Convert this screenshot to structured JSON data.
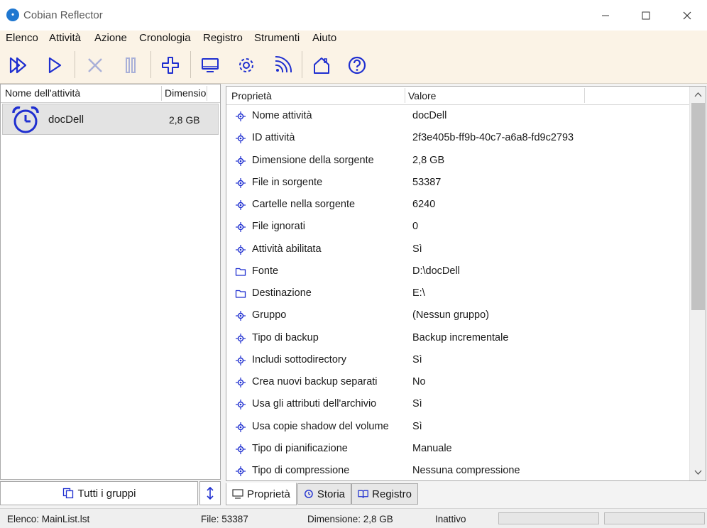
{
  "window": {
    "title": "Cobian Reflector"
  },
  "menu": [
    "Elenco",
    "Attività",
    "Azione",
    "Cronologia",
    "Registro",
    "Strumenti",
    "Aiuto"
  ],
  "toolbar": [
    "run-all-icon",
    "run-icon",
    "cancel-icon",
    "pause-icon",
    "add-icon",
    "monitor-icon",
    "settings-icon",
    "network-icon",
    "home-icon",
    "help-icon"
  ],
  "task_list": {
    "col_name": "Nome dell'attività",
    "col_size": "Dimensione",
    "items": [
      {
        "name": "docDell",
        "size": "2,8 GB",
        "icon": "alarm-clock-icon"
      }
    ],
    "group_button": "Tutti i gruppi"
  },
  "properties": {
    "col_property": "Proprietà",
    "col_value": "Valore",
    "rows": [
      {
        "name": "Nome attività",
        "value": "docDell",
        "icon": "property-icon"
      },
      {
        "name": "ID attività",
        "value": "2f3e405b-ff9b-40c7-a6a8-fd9c2793",
        "icon": "property-icon"
      },
      {
        "name": "Dimensione della sorgente",
        "value": "2,8 GB",
        "icon": "property-icon"
      },
      {
        "name": "File in sorgente",
        "value": "53387",
        "icon": "property-icon"
      },
      {
        "name": "Cartelle nella sorgente",
        "value": "6240",
        "icon": "property-icon"
      },
      {
        "name": "File ignorati",
        "value": "0",
        "icon": "property-icon"
      },
      {
        "name": "Attività abilitata",
        "value": "Sì",
        "icon": "property-icon"
      },
      {
        "name": "Fonte",
        "value": "D:\\docDell",
        "icon": "folder-icon"
      },
      {
        "name": "Destinazione",
        "value": "E:\\",
        "icon": "folder-icon"
      },
      {
        "name": "Gruppo",
        "value": "(Nessun gruppo)",
        "icon": "property-icon"
      },
      {
        "name": "Tipo di backup",
        "value": "Backup incrementale",
        "icon": "property-icon"
      },
      {
        "name": "Includi sottodirectory",
        "value": "Sì",
        "icon": "property-icon"
      },
      {
        "name": "Crea nuovi backup separati",
        "value": "No",
        "icon": "property-icon"
      },
      {
        "name": "Usa gli attributi dell'archivio",
        "value": "Sì",
        "icon": "property-icon"
      },
      {
        "name": "Usa copie shadow del volume",
        "value": "Sì",
        "icon": "property-icon"
      },
      {
        "name": "Tipo di pianificazione",
        "value": "Manuale",
        "icon": "property-icon"
      },
      {
        "name": "Tipo di compressione",
        "value": "Nessuna compressione",
        "icon": "property-icon"
      }
    ]
  },
  "tabs": [
    {
      "label": "Proprietà",
      "icon": "monitor-icon",
      "active": true
    },
    {
      "label": "Storia",
      "icon": "history-icon",
      "active": false
    },
    {
      "label": "Registro",
      "icon": "book-icon",
      "active": false
    }
  ],
  "status": {
    "list": "Elenco: MainList.lst",
    "files": "File: 53387",
    "size": "Dimensione: 2,8 GB",
    "state": "Inattivo"
  },
  "colors": {
    "accent": "#1f2fd0",
    "menu_bg": "#fbf3e6"
  }
}
